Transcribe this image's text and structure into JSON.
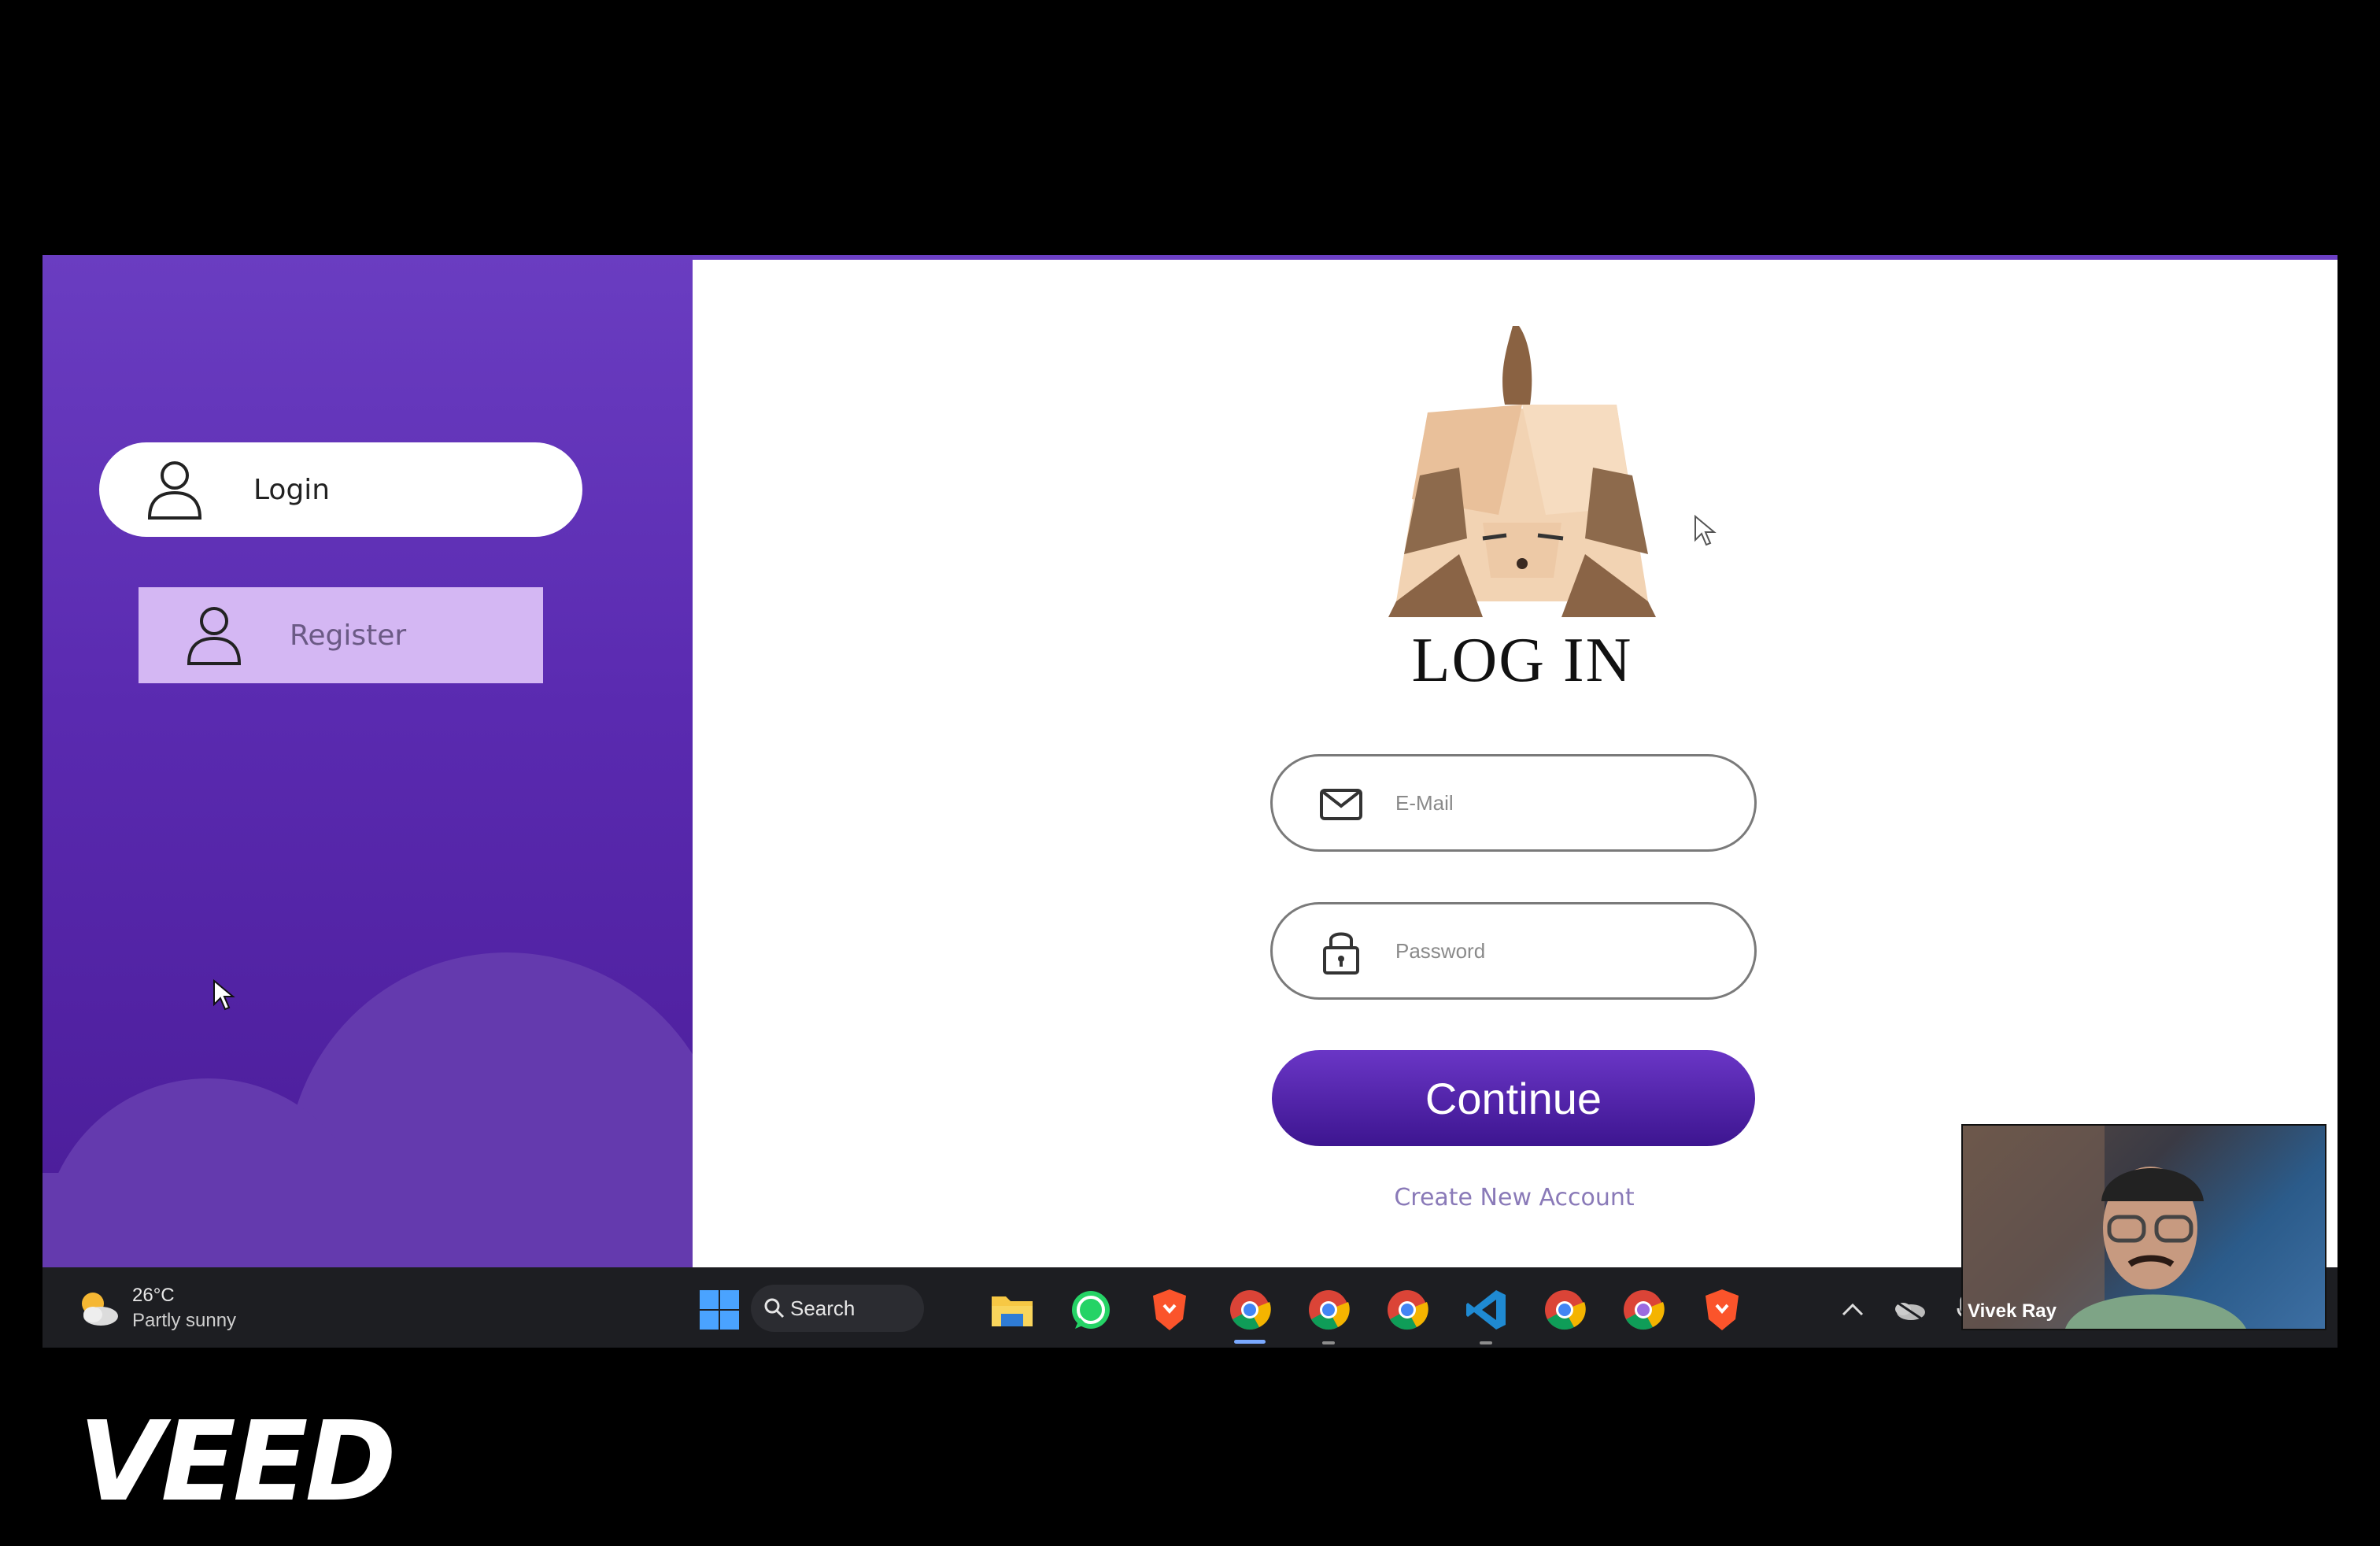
{
  "sidebar": {
    "login_label": "Login",
    "register_label": "Register"
  },
  "form": {
    "title": "LOG IN",
    "email_placeholder": "E-Mail",
    "password_placeholder": "Password",
    "continue_label": "Continue",
    "create_account_label": "Create New Account"
  },
  "taskbar": {
    "weather_temp": "26°C",
    "weather_desc": "Partly sunny",
    "search_label": "Search",
    "apps": [
      "windows-start",
      "file-explorer",
      "whatsapp",
      "brave",
      "chrome",
      "chrome",
      "chrome",
      "vscode",
      "chrome",
      "chrome",
      "brave"
    ]
  },
  "webcam": {
    "name": "Vivek Ray"
  },
  "watermark": {
    "text": "VEED"
  },
  "colors": {
    "accent_purple": "#5a2ab0",
    "register_bg": "#d4b7f3",
    "continue_btn": "#4a1fa0",
    "link": "#8a7ab8"
  }
}
